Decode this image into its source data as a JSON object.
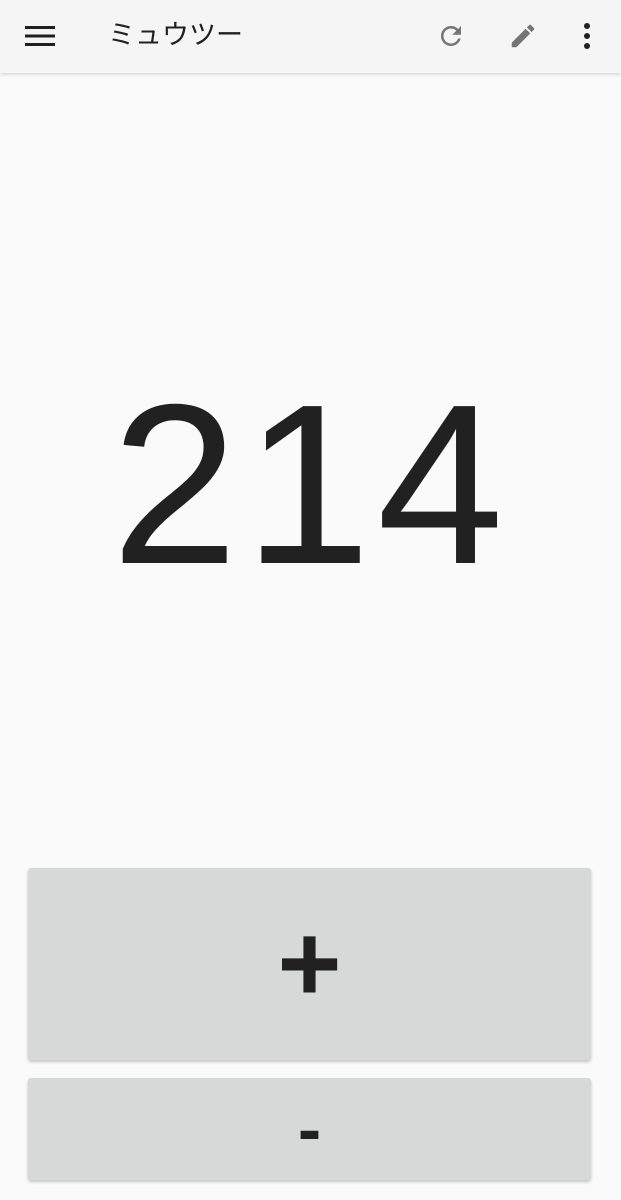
{
  "app_bar": {
    "title": "ミュウツー",
    "menu_icon": "hamburger-menu-icon",
    "actions": [
      "refresh-icon",
      "edit-pencil-icon",
      "more-vert-icon"
    ]
  },
  "counter": {
    "value": "214"
  },
  "buttons": {
    "increment_label": "+",
    "decrement_label": "-"
  },
  "colors": {
    "background": "#fafafa",
    "app_bar": "#f5f5f5",
    "button": "#d7d8d8",
    "text": "#212121",
    "icon_grey": "#757575"
  }
}
